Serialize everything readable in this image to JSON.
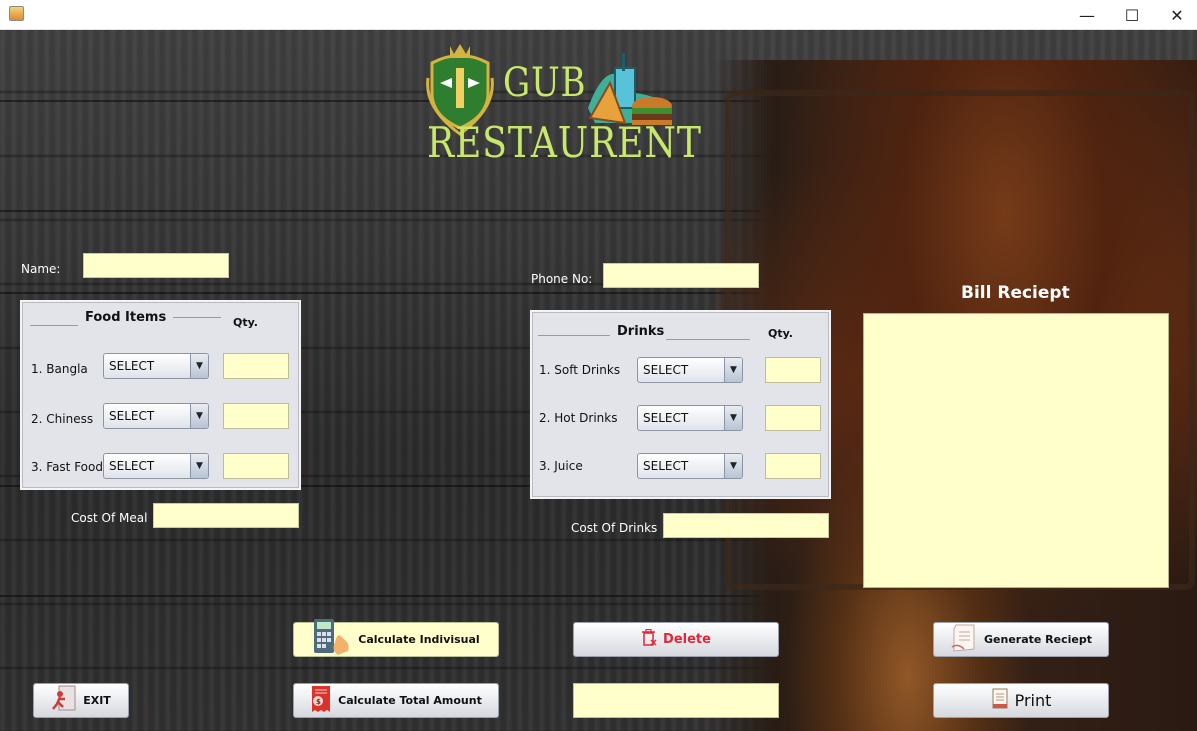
{
  "window": {
    "minimize_glyph": "—",
    "maximize_glyph": "☐",
    "close_glyph": "✕"
  },
  "logo": {
    "line1": "GUB",
    "line2": "RESTAURENT"
  },
  "customer": {
    "name_label": "Name:",
    "name_value": "",
    "phone_label": "Phone No:",
    "phone_value": ""
  },
  "food_panel": {
    "title": "Food Items",
    "qty_label": "Qty.",
    "items": [
      {
        "label": "1. Bangla",
        "selected": "SELECT",
        "qty": ""
      },
      {
        "label": "2. Chiness",
        "selected": "SELECT",
        "qty": ""
      },
      {
        "label": "3. Fast Food",
        "selected": "SELECT",
        "qty": ""
      }
    ],
    "cost_label": "Cost Of Meal",
    "cost_value": ""
  },
  "drinks_panel": {
    "title": "Drinks",
    "qty_label": "Qty.",
    "items": [
      {
        "label": "1. Soft Drinks",
        "selected": "SELECT",
        "qty": ""
      },
      {
        "label": "2. Hot Drinks",
        "selected": "SELECT",
        "qty": ""
      },
      {
        "label": "3. Juice",
        "selected": "SELECT",
        "qty": ""
      }
    ],
    "cost_label": "Cost Of Drinks",
    "cost_value": ""
  },
  "receipt": {
    "title": "Bill Reciept",
    "content": ""
  },
  "buttons": {
    "calc_individual": "Calculate Indivisual",
    "delete": "Delete",
    "generate_receipt": "Generate Reciept",
    "exit": "EXIT",
    "calc_total": "Calculate Total Amount",
    "print": "Print"
  },
  "total": {
    "value": ""
  },
  "colors": {
    "field_bg": "#ffffcc",
    "logo_text": "#c8e86b",
    "delete_text": "#e0283a",
    "panel_bg": "#e3e4ea"
  },
  "icons": {
    "calculator": "calculator-icon",
    "delete": "trash-icon",
    "receipt": "receipt-icon",
    "exit": "exit-icon",
    "total": "bill-icon",
    "print": "printer-icon"
  }
}
